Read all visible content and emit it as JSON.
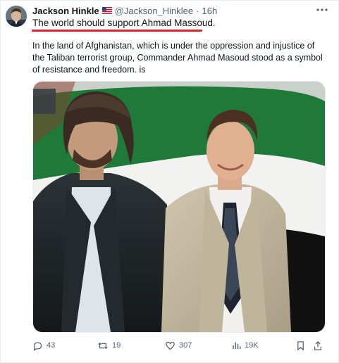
{
  "post": {
    "author_name": "Jackson Hinkle",
    "handle": "@Jackson_Hinklee",
    "separator": "·",
    "time": "16h",
    "headline": "The world should support Ahmad Massoud.",
    "body": "In the land of Afghanistan, which is under the oppression and injustice of the Taliban terrorist group, Commander Ahmad Masoud stood as a symbol of resistance and freedom.  is",
    "icons": {
      "more": "more-horizontal-icon",
      "flag": "us-flag-icon"
    }
  },
  "actions": {
    "replies": "43",
    "reposts": "19",
    "likes": "307",
    "views": "19K"
  },
  "colors": {
    "underline": "#e0222a",
    "secondary_text": "#536471",
    "flag_green": "#1f7a3a",
    "flag_black": "#111111"
  }
}
